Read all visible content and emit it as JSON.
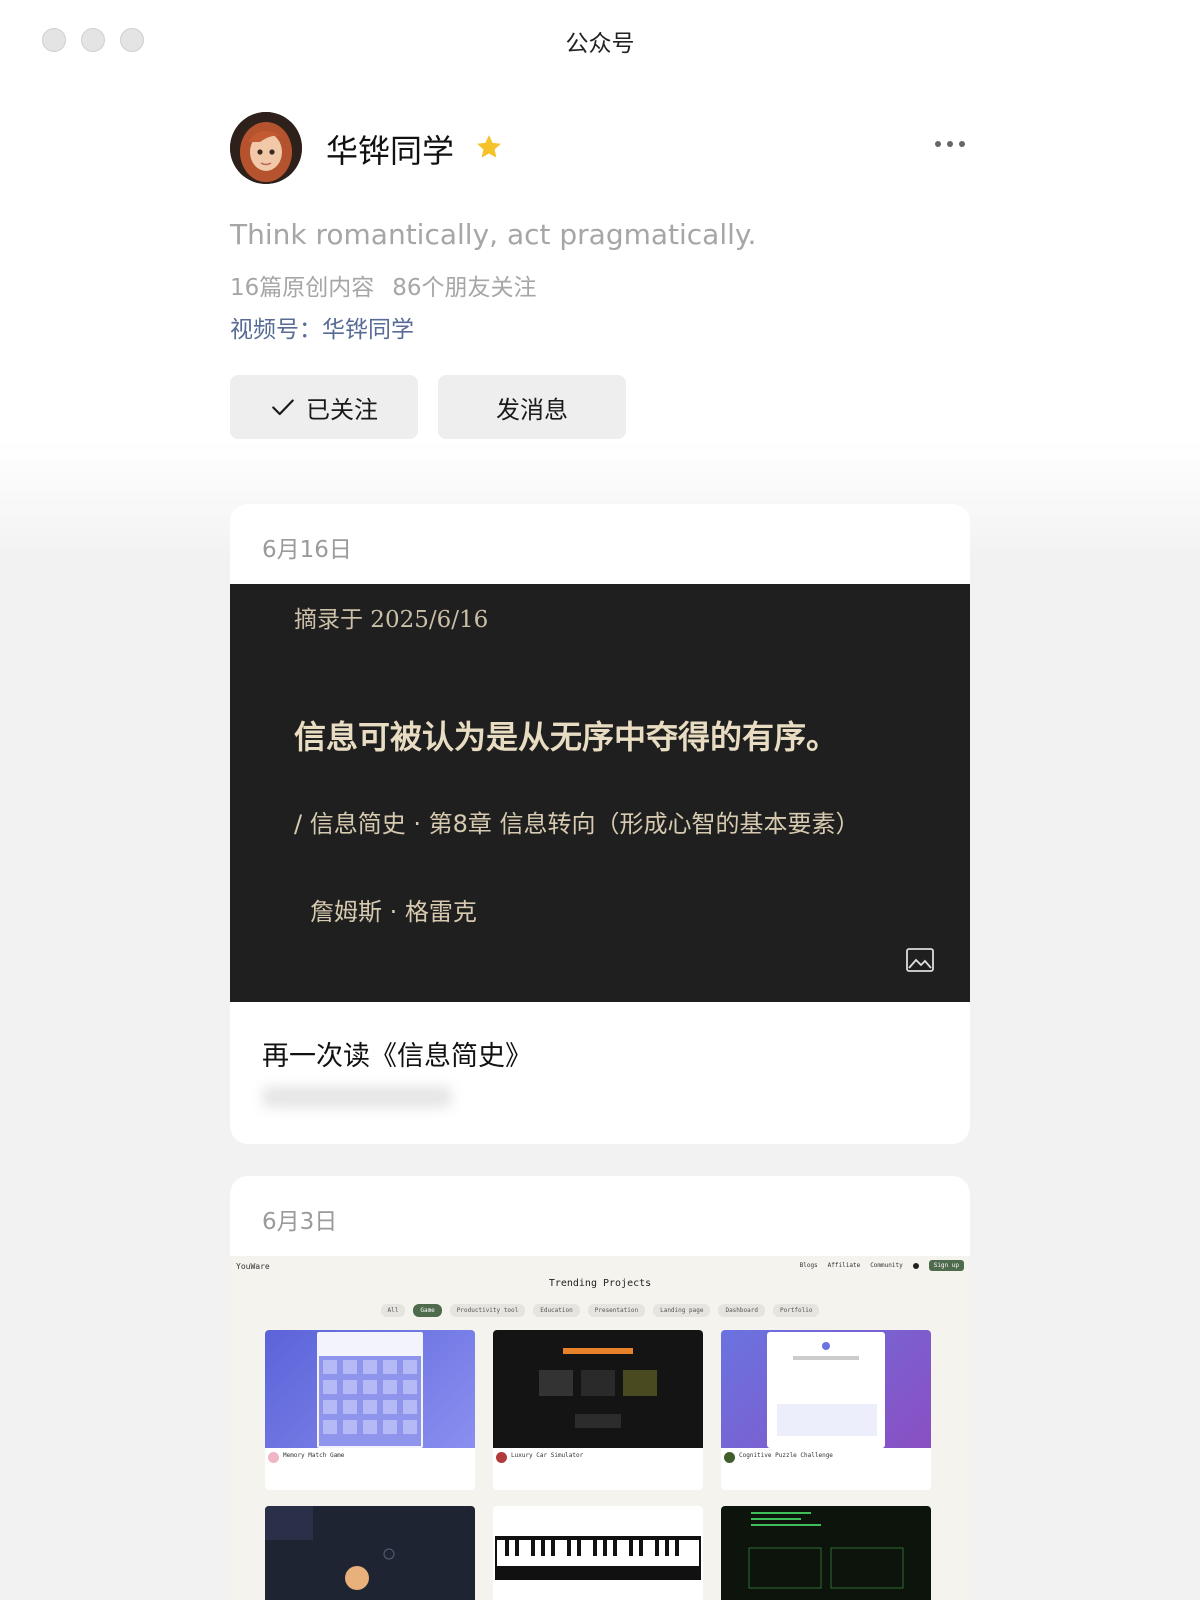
{
  "window": {
    "title": "公众号"
  },
  "profile": {
    "name": "华铧同学",
    "bio": "Think romantically, act pragmatically.",
    "original_count": "16篇原创内容",
    "followers": "86个朋友关注",
    "channel": "视频号：华铧同学",
    "follow_label": "已关注",
    "message_label": "发消息"
  },
  "articles": [
    {
      "date": "6月16日",
      "cover": {
        "meta": "摘录于 2025/6/16",
        "quote": "信息可被认为是从无序中夺得的有序。",
        "source": "/ 信息简史 · 第8章 信息转向（形成心智的基本要素）",
        "author": "詹姆斯 · 格雷克"
      },
      "title": "再一次读《信息简史》"
    },
    {
      "date": "6月3日",
      "screenshot": {
        "brand": "YouWare",
        "nav": [
          "Blogs",
          "Affiliate",
          "Community"
        ],
        "signup": "Sign up",
        "heading": "Trending Projects",
        "filters": [
          "All",
          "Game",
          "Productivity tool",
          "Education",
          "Presentation",
          "Landing page",
          "Dashboard",
          "Portfolio"
        ],
        "active_filter": "Game",
        "projects": [
          "Memory Match Game",
          "Luxury Car Simulator",
          "Cognitive Puzzle Challenge"
        ]
      }
    }
  ],
  "colors": {
    "link": "#576b95",
    "muted": "#a6a6a6",
    "star": "#f5c22a",
    "button_bg": "#eeeeee"
  },
  "icons": {
    "verified": "star-icon",
    "more": "more-dots-icon",
    "check": "check-icon",
    "image": "image-icon"
  }
}
